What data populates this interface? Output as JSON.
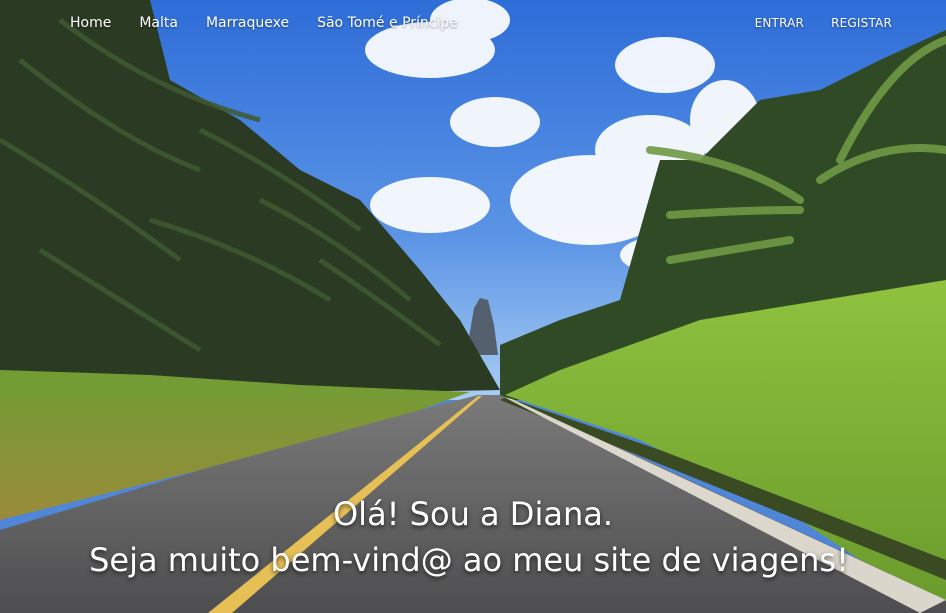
{
  "nav": {
    "left": [
      "Home",
      "Malta",
      "Marraquexe",
      "São Tomé e Príncipe"
    ],
    "right": [
      "ENTRAR",
      "REGISTAR"
    ]
  },
  "hero": {
    "greeting": "Olá! Sou a Diana.",
    "welcome": "Seja muito bem-vind@ ao meu site de viagens!"
  },
  "colors": {
    "sky_top": "#2f6fd6",
    "sky_bottom": "#9ec3ee",
    "road": "#5b5b5c",
    "road_line": "#e8c25a",
    "grass": "#7fae3a",
    "palm_dark": "#1f2d19"
  }
}
